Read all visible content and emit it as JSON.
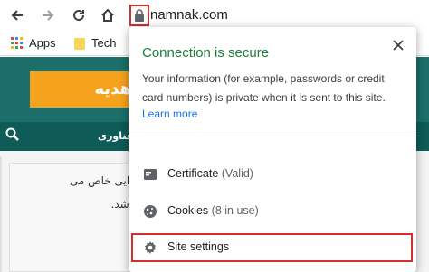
{
  "browser": {
    "url_text": "namnak.com"
  },
  "bookmarks": {
    "items": [
      {
        "label": "Apps"
      },
      {
        "label": "Tech"
      }
    ]
  },
  "site": {
    "banner_text": "هدیه",
    "nav_label": "فناوری",
    "paragraph_line1": "د از مواد غذایی خاص می",
    "paragraph_line2": "غذایی می باشد."
  },
  "popup": {
    "title": "Connection is secure",
    "description": "Your information (for example, passwords or credit card numbers) is private when it is sent to this site.",
    "learn_more": "Learn more",
    "rows": [
      {
        "label": "Certificate",
        "sub": "(Valid)"
      },
      {
        "label": "Cookies",
        "sub": "(8 in use)"
      },
      {
        "label": "Site settings",
        "sub": ""
      }
    ]
  },
  "colors": {
    "secure_green": "#188038",
    "link_blue": "#1a73e8",
    "highlight_red": "#d32f2f",
    "site_teal": "#1b6e6a",
    "banner_orange": "#f5a21d"
  }
}
